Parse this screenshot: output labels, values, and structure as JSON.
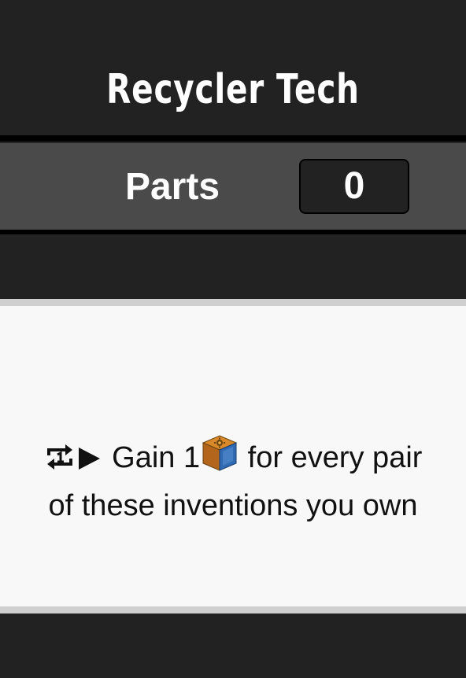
{
  "card": {
    "title": "Recycler Tech"
  },
  "parts": {
    "label": "Parts",
    "count": "0"
  },
  "effect": {
    "trigger_icon": "repeat-once-icon",
    "arrow_icon": "play-arrow-icon",
    "gain_text": "Gain 1",
    "resource_icon": "parts-crate-icon",
    "rest_text": "for every pair of these inventions you own"
  }
}
